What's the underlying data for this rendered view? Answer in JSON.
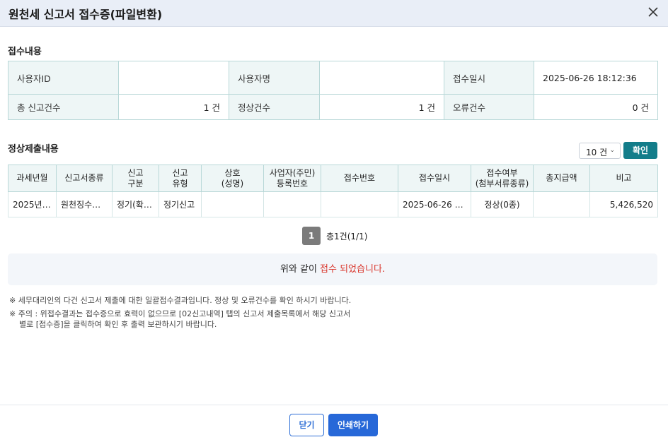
{
  "dialog": {
    "title": "원천세 신고서 접수증(파일변환)",
    "close_icon": "close-icon"
  },
  "receipt": {
    "section_title": "접수내용",
    "user_id_label": "사용자ID",
    "user_id_value": "",
    "user_name_label": "사용자명",
    "user_name_value": "",
    "received_at_label": "접수일시",
    "received_at_value": "2025-06-26  18:12:36",
    "total_count_label": "총 신고건수",
    "total_count_value": "1 건",
    "normal_count_label": "정상건수",
    "normal_count_value": "1 건",
    "error_count_label": "오류건수",
    "error_count_value": "0 건"
  },
  "submission": {
    "section_title": "정상제출내용",
    "page_size": "10 건",
    "confirm_label": "확인",
    "headers": {
      "c1": "과세년월",
      "c2": "신고서종류",
      "c3a": "신고",
      "c3b": "구분",
      "c4a": "신고",
      "c4b": "유형",
      "c5a": "상호",
      "c5b": "(성명)",
      "c6a": "사업자(주민)",
      "c6b": "등록번호",
      "c7": "접수번호",
      "c8": "접수일시",
      "c9a": "접수여부",
      "c9b": "(첨부서류종류)",
      "c10": "총지급액",
      "c11": "비고"
    },
    "rows": [
      {
        "c1": "2025년…",
        "c2": "원천징수이…",
        "c3": "정기(확정)",
        "c4": "정기신고",
        "c5": "",
        "c6": "",
        "c7": "",
        "c8": "2025-06-26 1…",
        "c9": "정상(0종)",
        "c10": "",
        "c11": "5,426,520"
      }
    ]
  },
  "pagination": {
    "current_page": "1",
    "summary": "총1건(1/1)"
  },
  "notice": {
    "prefix": "위와 같이 ",
    "highlight": "접수 되었습니다.",
    "highlight_color": "#d9362c"
  },
  "notes": {
    "line1": "※ 세무대리인의 다건 신고서 제출에 대한 일괄접수결과입니다. 정상 및 오류건수를 확인 하시기 바랍니다.",
    "line2a": "※ 주의 : 위접수결과는 접수증으로 효력이 없으므로 [02신고내역] 탭의 신고서 제출목록에서 해당 신고서",
    "line2b": "별로 [접수증]을 클릭하여 확인 후 출력 보관하시기 바랍니다."
  },
  "footer": {
    "close_label": "닫기",
    "print_label": "인쇄하기"
  },
  "colors": {
    "title_bar": "#e9eef7",
    "confirm_button": "#137d8a",
    "primary_button": "#2768d8",
    "label_cell": "#eef6f6"
  }
}
